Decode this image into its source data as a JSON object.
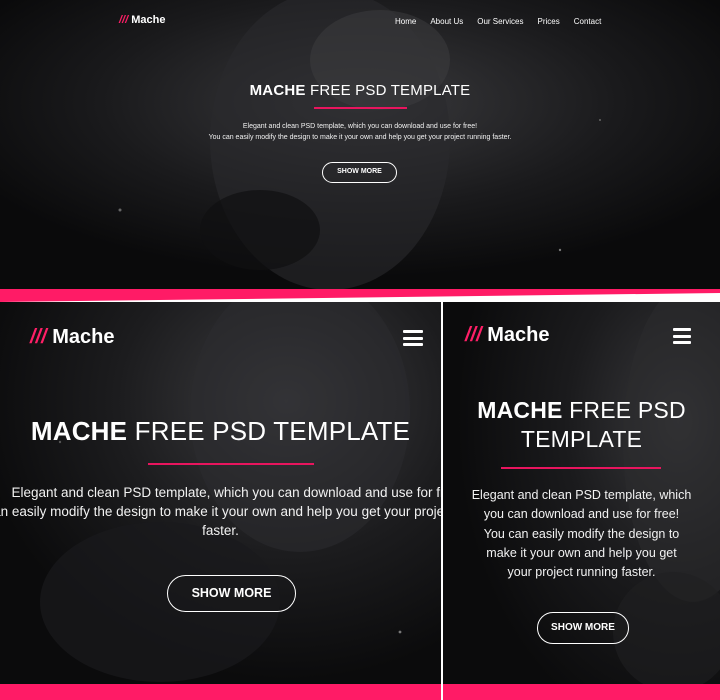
{
  "brand": {
    "slashes": "///",
    "name": "Mache"
  },
  "nav": {
    "items": [
      "Home",
      "About Us",
      "Our Services",
      "Prices",
      "Contact"
    ]
  },
  "hero": {
    "title_bold": "MACHE",
    "title_rest": "FREE PSD TEMPLATE",
    "desc_line1": "Elegant and clean PSD template, which you can download and use for free!",
    "desc_line2": "You can easily modify the design to make it your own and help you get your project running faster.",
    "button": "SHOW MORE"
  },
  "tablet": {
    "desc_line1": "Elegant and clean PSD template, which you can download and use for free",
    "desc_line2": "can easily modify the design to make it your own and help you get your project",
    "desc_line3": "faster."
  },
  "mobile": {
    "title_line2": "TEMPLATE",
    "desc_lines": [
      "Elegant and clean PSD template, which",
      "you can download and use for free!",
      "You can easily modify the design to",
      "make it your own and help you get",
      "your project running faster."
    ]
  },
  "colors": {
    "accent": "#ff1b66",
    "background": "#0d0d0e",
    "text": "#ffffff"
  },
  "icons": {
    "menu": "hamburger-menu-icon"
  }
}
